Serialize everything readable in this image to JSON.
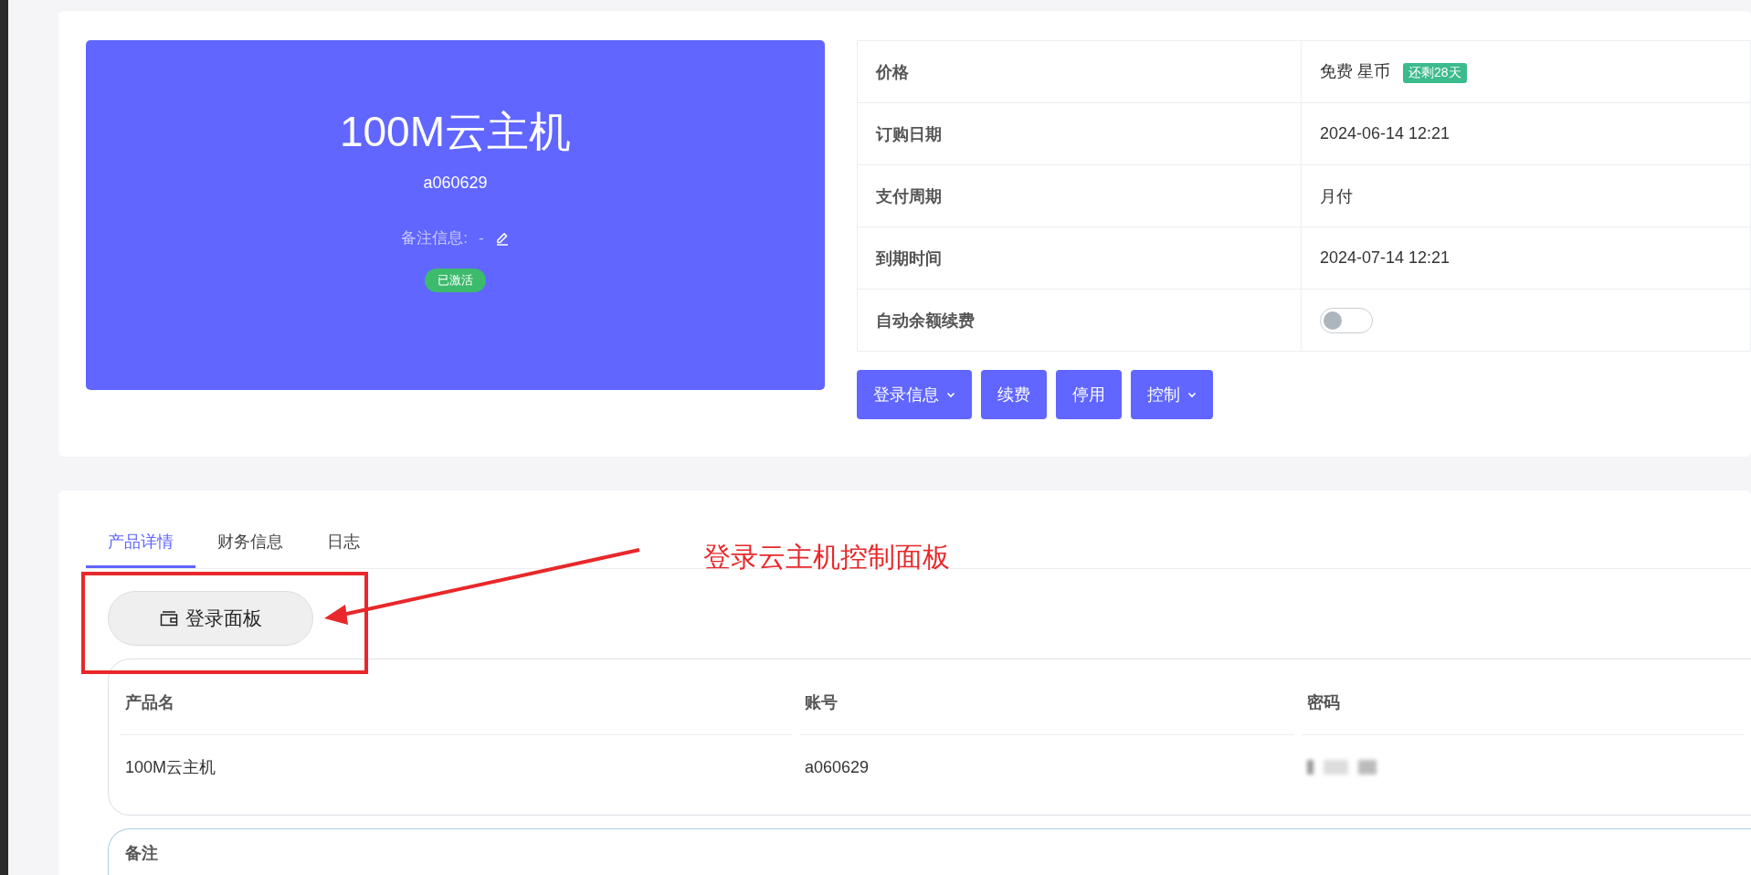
{
  "product": {
    "name": "100M云主机",
    "id": "a060629",
    "note_label": "备注信息:",
    "note_value": "-",
    "status": "已激活"
  },
  "info": [
    {
      "kind": "text",
      "label": "价格",
      "value": "免费 星币",
      "badge": "还剩28天"
    },
    {
      "kind": "text",
      "label": "订购日期",
      "value": "2024-06-14 12:21"
    },
    {
      "kind": "text",
      "label": "支付周期",
      "value": "月付"
    },
    {
      "kind": "text",
      "label": "到期时间",
      "value": "2024-07-14 12:21"
    },
    {
      "kind": "toggle",
      "label": "自动余额续费",
      "on": false
    }
  ],
  "actions": [
    {
      "label": "登录信息",
      "dropdown": true
    },
    {
      "label": "续费",
      "dropdown": false
    },
    {
      "label": "停用",
      "dropdown": false
    },
    {
      "label": "控制",
      "dropdown": true
    }
  ],
  "tabs": [
    {
      "label": "产品详情",
      "selected": true
    },
    {
      "label": "财务信息",
      "selected": false
    },
    {
      "label": "日志",
      "selected": false
    }
  ],
  "panel_button": "登录面板",
  "annotation": "登录云主机控制面板",
  "table": {
    "columns": [
      "产品名",
      "账号",
      "密码"
    ],
    "rows": [
      {
        "product": "100M云主机",
        "account": "a060629",
        "password_blurred": true
      }
    ]
  },
  "notes_section": {
    "title": "备注"
  }
}
